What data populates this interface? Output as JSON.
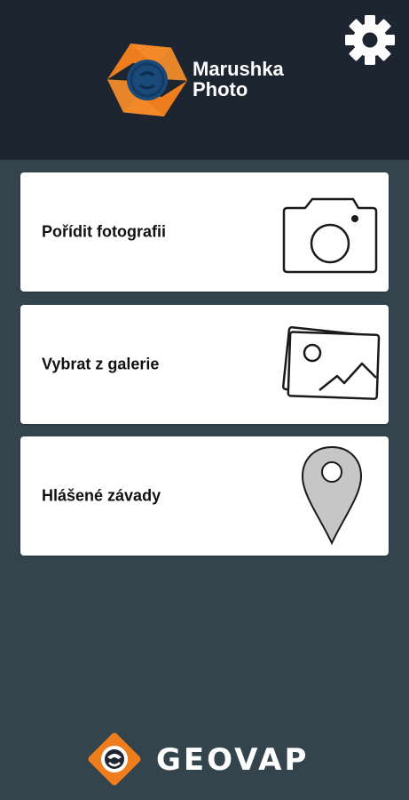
{
  "app": {
    "logo_line1": "Marushka",
    "logo_line2": "Photo",
    "settings_icon": "gear-icon"
  },
  "menu": {
    "items": [
      {
        "label": "Pořídit fotografii",
        "icon": "camera-icon"
      },
      {
        "label": "Vybrat z galerie",
        "icon": "gallery-icon"
      },
      {
        "label": "Hlášené závady",
        "icon": "location-pin-icon"
      }
    ]
  },
  "footer": {
    "brand": "GEOVAP"
  },
  "colors": {
    "header_bg": "#1d2530",
    "page_bg": "#34444c",
    "card_bg": "#ffffff",
    "accent_orange": "#ee7d1d",
    "logo_blue": "#1a4a7a",
    "text_dark": "#111111",
    "pin_fill": "#c6c6c6"
  }
}
